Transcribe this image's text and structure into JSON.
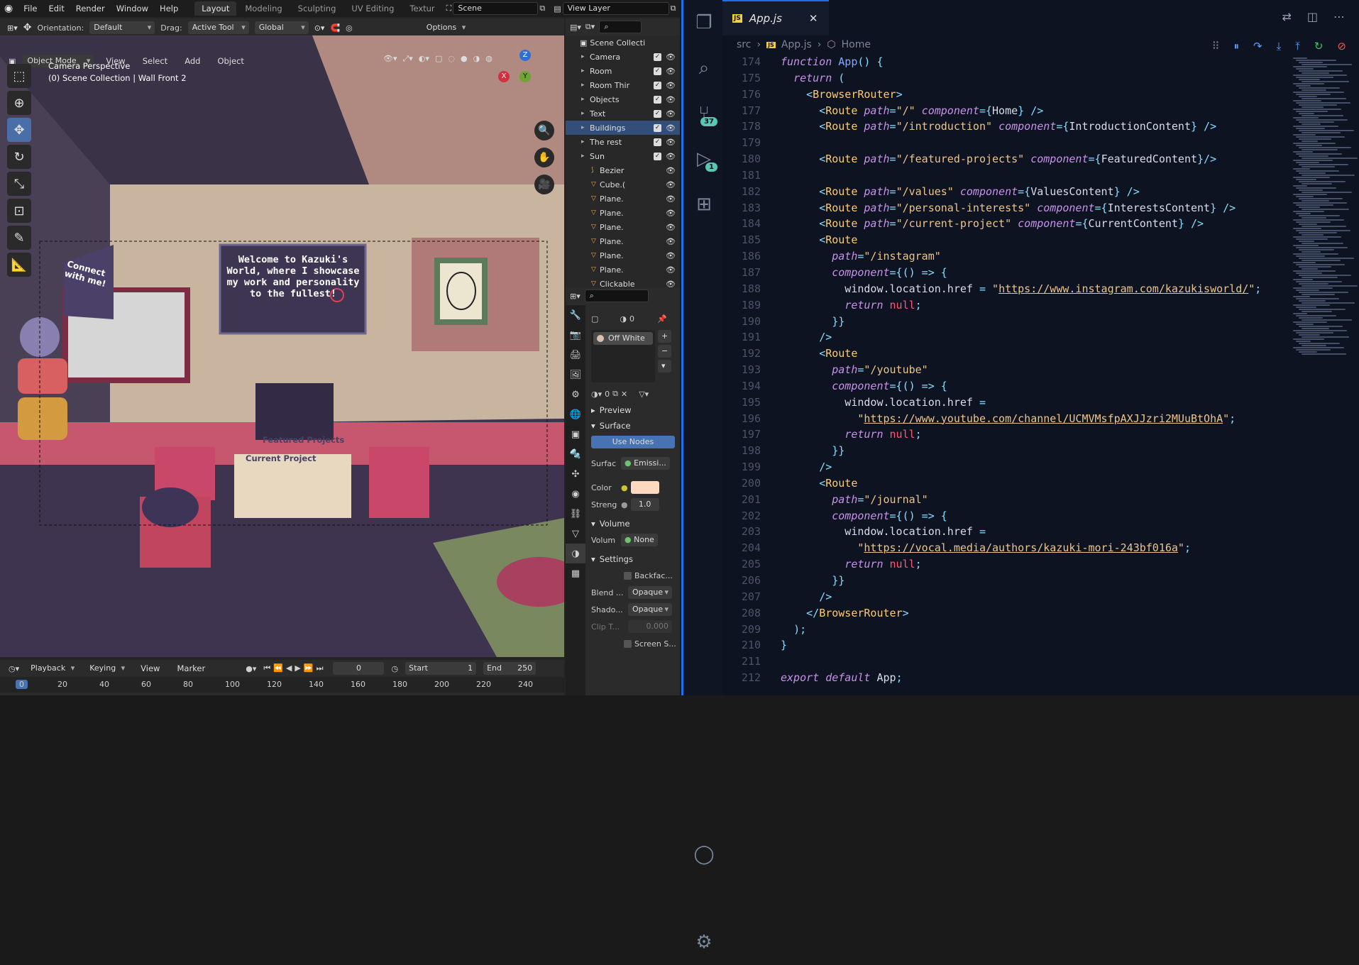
{
  "blender": {
    "menus": [
      "File",
      "Edit",
      "Render",
      "Window",
      "Help"
    ],
    "workspaces": [
      "Layout",
      "Modeling",
      "Sculpting",
      "UV Editing",
      "Textur"
    ],
    "scene": "Scene",
    "view_layer": "View Layer",
    "header": {
      "orientation_label": "Orientation:",
      "orientation": "Default",
      "drag_label": "Drag:",
      "drag": "Active Tool",
      "transform": "Global",
      "options": "Options"
    },
    "mode": "Object Mode",
    "view_menus": [
      "View",
      "Select",
      "Add",
      "Object"
    ],
    "viewport": {
      "camera_title": "Camera Perspective",
      "collection": "(0) Scene Collection | Wall Front 2",
      "sign_text": "Welcome to Kazuki's World, where I showcase my work and personality to the fullest!",
      "connect_text": "Connect with me!",
      "featured": "Featured Projects",
      "current": "Current Project"
    },
    "outliner": {
      "root": "Scene Collecti",
      "items": [
        {
          "name": "Camera",
          "selected": false,
          "level": 0
        },
        {
          "name": "Room",
          "selected": false,
          "level": 0
        },
        {
          "name": "Room Thir",
          "selected": false,
          "level": 0
        },
        {
          "name": "Objects",
          "selected": false,
          "level": 0
        },
        {
          "name": "Text",
          "selected": false,
          "level": 0
        },
        {
          "name": "Buildings",
          "selected": true,
          "level": 0
        },
        {
          "name": "The rest",
          "selected": false,
          "level": 0
        },
        {
          "name": "Sun",
          "selected": false,
          "level": 0
        },
        {
          "name": "Bezier",
          "selected": false,
          "level": 1
        },
        {
          "name": "Cube.(",
          "selected": false,
          "level": 1
        },
        {
          "name": "Plane.",
          "selected": false,
          "level": 1
        },
        {
          "name": "Plane.",
          "selected": false,
          "level": 1
        },
        {
          "name": "Plane.",
          "selected": false,
          "level": 1
        },
        {
          "name": "Plane.",
          "selected": false,
          "level": 1
        },
        {
          "name": "Plane.",
          "selected": false,
          "level": 1
        },
        {
          "name": "Plane.",
          "selected": false,
          "level": 1
        },
        {
          "name": "Clickable",
          "selected": false,
          "level": 1
        }
      ]
    },
    "properties": {
      "material_slot": "Off White",
      "slot_count": "0",
      "preview": "Preview",
      "surface": "Surface",
      "use_nodes": "Use Nodes",
      "surface_label": "Surfac",
      "surface_val": "Emissi...",
      "color_label": "Color",
      "strength_label": "Streng",
      "strength_val": "1.0",
      "volume": "Volume",
      "volume_label": "Volum",
      "volume_val": "None",
      "settings": "Settings",
      "backface": "Backfac...",
      "blend_label": "Blend ...",
      "blend_val": "Opaque",
      "shadow_label": "Shado...",
      "shadow_val": "Opaque",
      "clip_label": "Clip T...",
      "clip_val": "0.000",
      "screen_space": "Screen S..."
    },
    "timeline": {
      "menus": [
        "Playback",
        "Keying",
        "View",
        "Marker"
      ],
      "frame": "0",
      "start_label": "Start",
      "start": "1",
      "end_label": "End",
      "end": "250",
      "ruler": [
        "0",
        "20",
        "40",
        "60",
        "80",
        "100",
        "120",
        "140",
        "160",
        "180",
        "200",
        "220",
        "240"
      ]
    }
  },
  "vscode": {
    "tab": "App.js",
    "breadcrumb": [
      "src",
      "App.js",
      "Home"
    ],
    "badges": {
      "scm": "37",
      "debug": "1"
    },
    "lines": [
      {
        "n": "174",
        "h": "<span class=\"kw\">function</span> <span class=\"fn\">App</span><span class=\"pun\">() {</span>"
      },
      {
        "n": "175",
        "h": "  <span class=\"kw\">return</span> <span class=\"pun\">(</span>"
      },
      {
        "n": "176",
        "h": "    <span class=\"pun\">&lt;</span><span class=\"tag\">BrowserRouter</span><span class=\"pun\">&gt;</span>"
      },
      {
        "n": "177",
        "h": "      <span class=\"pun\">&lt;</span><span class=\"tag\">Route</span> <span class=\"attr\">path</span><span class=\"pun\">=</span><span class=\"str\">\"/\"</span> <span class=\"attr\">component</span><span class=\"pun\">={</span>Home<span class=\"pun\">} /&gt;</span>"
      },
      {
        "n": "178",
        "h": "      <span class=\"pun\">&lt;</span><span class=\"tag\">Route</span> <span class=\"attr\">path</span><span class=\"pun\">=</span><span class=\"str\">\"/introduction\"</span> <span class=\"attr\">component</span><span class=\"pun\">={</span>IntroductionContent<span class=\"pun\">} /&gt;</span>"
      },
      {
        "n": "179",
        "h": ""
      },
      {
        "n": "180",
        "h": "      <span class=\"pun\">&lt;</span><span class=\"tag\">Route</span> <span class=\"attr\">path</span><span class=\"pun\">=</span><span class=\"str\">\"/featured-projects\"</span> <span class=\"attr\">component</span><span class=\"pun\">={</span>FeaturedContent<span class=\"pun\">}/&gt;</span>"
      },
      {
        "n": "181",
        "h": ""
      },
      {
        "n": "182",
        "h": "      <span class=\"pun\">&lt;</span><span class=\"tag\">Route</span> <span class=\"attr\">path</span><span class=\"pun\">=</span><span class=\"str\">\"/values\"</span> <span class=\"attr\">component</span><span class=\"pun\">={</span>ValuesContent<span class=\"pun\">} /&gt;</span>"
      },
      {
        "n": "183",
        "h": "      <span class=\"pun\">&lt;</span><span class=\"tag\">Route</span> <span class=\"attr\">path</span><span class=\"pun\">=</span><span class=\"str\">\"/personal-interests\"</span> <span class=\"attr\">component</span><span class=\"pun\">={</span>InterestsContent<span class=\"pun\">} /&gt;</span>"
      },
      {
        "n": "184",
        "h": "      <span class=\"pun\">&lt;</span><span class=\"tag\">Route</span> <span class=\"attr\">path</span><span class=\"pun\">=</span><span class=\"str\">\"/current-project\"</span> <span class=\"attr\">component</span><span class=\"pun\">={</span>CurrentContent<span class=\"pun\">} /&gt;</span>"
      },
      {
        "n": "185",
        "h": "      <span class=\"pun\">&lt;</span><span class=\"tag\">Route</span>"
      },
      {
        "n": "186",
        "h": "        <span class=\"attr\">path</span><span class=\"pun\">=</span><span class=\"str\">\"/instagram\"</span>"
      },
      {
        "n": "187",
        "h": "        <span class=\"attr\">component</span><span class=\"pun\">={() =&gt; {</span>"
      },
      {
        "n": "188",
        "h": "          window.location.href <span class=\"pun\">=</span> <span class=\"str\">\"</span><span class=\"url\">https://www.instagram.com/kazukisworld/</span><span class=\"str\">\"</span><span class=\"pun\">;</span>"
      },
      {
        "n": "189",
        "h": "          <span class=\"kw\">return</span> <span class=\"nul\">null</span><span class=\"pun\">;</span>"
      },
      {
        "n": "190",
        "h": "        <span class=\"pun\">}}</span>"
      },
      {
        "n": "191",
        "h": "      <span class=\"pun\">/&gt;</span>"
      },
      {
        "n": "192",
        "h": "      <span class=\"pun\">&lt;</span><span class=\"tag\">Route</span>"
      },
      {
        "n": "193",
        "h": "        <span class=\"attr\">path</span><span class=\"pun\">=</span><span class=\"str\">\"/youtube\"</span>"
      },
      {
        "n": "194",
        "h": "        <span class=\"attr\">component</span><span class=\"pun\">={() =&gt; {</span>"
      },
      {
        "n": "195",
        "h": "          window.location.href <span class=\"pun\">=</span>"
      },
      {
        "n": "196",
        "h": "            <span class=\"str\">\"</span><span class=\"url\">https://www.youtube.com/channel/UCMVMsfpAXJJzri2MUuBtOhA</span><span class=\"str\">\"</span><span class=\"pun\">;</span>"
      },
      {
        "n": "197",
        "h": "          <span class=\"kw\">return</span> <span class=\"nul\">null</span><span class=\"pun\">;</span>"
      },
      {
        "n": "198",
        "h": "        <span class=\"pun\">}}</span>"
      },
      {
        "n": "199",
        "h": "      <span class=\"pun\">/&gt;</span>"
      },
      {
        "n": "200",
        "h": "      <span class=\"pun\">&lt;</span><span class=\"tag\">Route</span>"
      },
      {
        "n": "201",
        "h": "        <span class=\"attr\">path</span><span class=\"pun\">=</span><span class=\"str\">\"/journal\"</span>"
      },
      {
        "n": "202",
        "h": "        <span class=\"attr\">component</span><span class=\"pun\">={() =&gt; {</span>"
      },
      {
        "n": "203",
        "h": "          window.location.href <span class=\"pun\">=</span>"
      },
      {
        "n": "204",
        "h": "            <span class=\"str\">\"</span><span class=\"url\">https://vocal.media/authors/kazuki-mori-243bf016a</span><span class=\"str\">\"</span><span class=\"pun\">;</span>"
      },
      {
        "n": "205",
        "h": "          <span class=\"kw\">return</span> <span class=\"nul\">null</span><span class=\"pun\">;</span>"
      },
      {
        "n": "206",
        "h": "        <span class=\"pun\">}}</span>"
      },
      {
        "n": "207",
        "h": "      <span class=\"pun\">/&gt;</span>"
      },
      {
        "n": "208",
        "h": "    <span class=\"pun\">&lt;/</span><span class=\"tag\">BrowserRouter</span><span class=\"pun\">&gt;</span>"
      },
      {
        "n": "209",
        "h": "  <span class=\"pun\">);</span>"
      },
      {
        "n": "210",
        "h": "<span class=\"pun\">}</span>"
      },
      {
        "n": "211",
        "h": ""
      },
      {
        "n": "212",
        "h": "<span class=\"kw\">export default</span> App<span class=\"pun\">;</span>"
      }
    ]
  }
}
